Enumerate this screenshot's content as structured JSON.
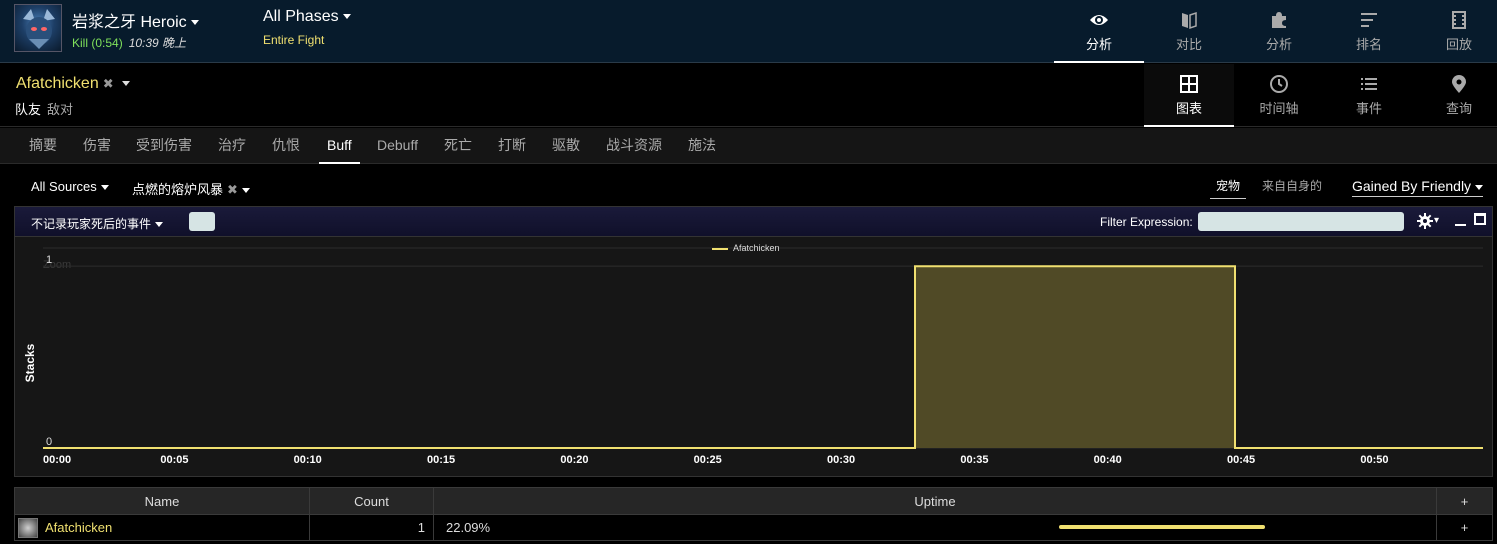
{
  "header": {
    "boss_title": "岩浆之牙 Heroic",
    "kill_text": "Kill (0:54)",
    "kill_time": "10:39 晚上",
    "phase_title": "All Phases",
    "phase_sub": "Entire Fight",
    "nav": [
      {
        "label": "分析",
        "icon": "eye-icon",
        "active": true
      },
      {
        "label": "对比",
        "icon": "compare-icon",
        "active": false
      },
      {
        "label": "分析",
        "icon": "puzzle-icon",
        "active": false
      },
      {
        "label": "排名",
        "icon": "rankings-icon",
        "active": false
      },
      {
        "label": "回放",
        "icon": "film-icon",
        "active": false
      }
    ]
  },
  "player": {
    "name": "Afatchicken",
    "close_glyph": "✖",
    "friendly_label": "队友",
    "enemy_label": "敌对",
    "views": [
      {
        "label": "图表",
        "icon": "grid-icon",
        "active": true
      },
      {
        "label": "时间轴",
        "icon": "clock-icon",
        "active": false
      },
      {
        "label": "事件",
        "icon": "list-icon",
        "active": false
      },
      {
        "label": "查询",
        "icon": "map-pin-icon",
        "active": false
      }
    ]
  },
  "tabs": [
    "摘要",
    "伤害",
    "受到伤害",
    "治疗",
    "仇恨",
    "Buff",
    "Debuff",
    "死亡",
    "打断",
    "驱散",
    "战斗资源",
    "施法"
  ],
  "active_tab": "Buff",
  "filters": {
    "source": "All Sources",
    "ability": "点燃的熔炉风暴",
    "close_glyph": "✖",
    "pets_label": "宠物",
    "self_label": "来自自身的",
    "gained_label": "Gained By Friendly"
  },
  "panel": {
    "death_label": "不记录玩家死后的事件",
    "filter_label": "Filter Expression:",
    "filter_value": "",
    "gear_caret": "▾"
  },
  "chart_data": {
    "type": "area",
    "watermark": "Zoom",
    "ylabel": "Stacks",
    "ylim": [
      0,
      1.1
    ],
    "xlim": [
      0,
      54
    ],
    "y_ticks": [
      {
        "value": 0,
        "label": "0"
      },
      {
        "value": 1,
        "label": "1"
      }
    ],
    "x_ticks": [
      {
        "value": 0,
        "label": "00:00"
      },
      {
        "value": 5,
        "label": "00:05"
      },
      {
        "value": 10,
        "label": "00:10"
      },
      {
        "value": 15,
        "label": "00:15"
      },
      {
        "value": 20,
        "label": "00:20"
      },
      {
        "value": 25,
        "label": "00:25"
      },
      {
        "value": 30,
        "label": "00:30"
      },
      {
        "value": 35,
        "label": "00:35"
      },
      {
        "value": 40,
        "label": "00:40"
      },
      {
        "value": 45,
        "label": "00:45"
      },
      {
        "value": 50,
        "label": "00:50"
      }
    ],
    "legend_position": "top-center",
    "series": [
      {
        "name": "Afatchicken",
        "color": "#f0e070",
        "fill": "#504a26",
        "points": [
          [
            0,
            0
          ],
          [
            32.7,
            0
          ],
          [
            32.7,
            1
          ],
          [
            44.7,
            1
          ],
          [
            44.7,
            0
          ],
          [
            54,
            0
          ]
        ]
      }
    ]
  },
  "table": {
    "headers": {
      "name": "Name",
      "count": "Count",
      "uptime": "Uptime",
      "plus": "+"
    },
    "rows": [
      {
        "name": "Afatchicken",
        "count": "1",
        "uptime": "22.09%",
        "uptime_fraction": 0.2209,
        "plus": "+"
      }
    ]
  }
}
